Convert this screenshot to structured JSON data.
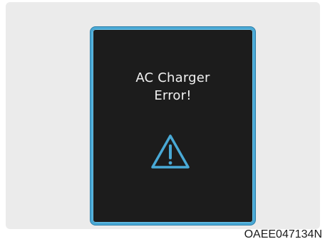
{
  "display": {
    "message_line1": "AC Charger",
    "message_line2": "Error!",
    "icon": "warning-triangle-icon",
    "border_color": "#49a9d6",
    "background_color": "#1c1c1c",
    "text_color": "#f2f2f2"
  },
  "caption": {
    "code": "OAEE047134N"
  }
}
